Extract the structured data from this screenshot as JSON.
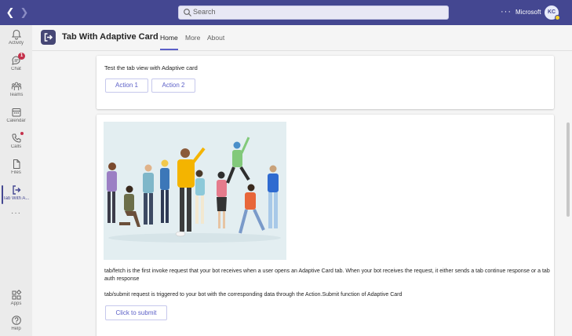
{
  "titlebar": {
    "search_placeholder": "Search",
    "org_name": "Microsoft",
    "avatar_initials": "KC",
    "more_glyph": "···"
  },
  "rail": {
    "items": [
      {
        "label": "Activity",
        "icon": "bell-icon"
      },
      {
        "label": "Chat",
        "icon": "chat-icon",
        "badge": "1"
      },
      {
        "label": "Teams",
        "icon": "teams-icon"
      },
      {
        "label": "Calendar",
        "icon": "calendar-icon"
      },
      {
        "label": "Calls",
        "icon": "phone-icon"
      },
      {
        "label": "Files",
        "icon": "file-icon"
      },
      {
        "label": "Tab With A...",
        "icon": "app-icon"
      },
      {
        "label": "Apps",
        "icon": "apps-icon"
      },
      {
        "label": "Help",
        "icon": "help-icon"
      }
    ],
    "more_glyph": "···"
  },
  "header": {
    "app_title": "Tab With Adaptive Card",
    "tabs": [
      {
        "label": "Home",
        "active": true
      },
      {
        "label": "More",
        "active": false
      },
      {
        "label": "About",
        "active": false
      }
    ]
  },
  "card1": {
    "text": "Test the tab view with Adaptive card",
    "action1": "Action 1",
    "action2": "Action 2"
  },
  "card2": {
    "para1": "tab/fetch is the first invoke request that your bot receives when a user opens an Adaptive Card tab. When your bot receives the request, it either sends a tab continue response or a tab auth response",
    "para2": "tab/submit request is triggered to your bot with the corresponding data through the Action.Submit function of Adaptive Card",
    "submit": "Click to submit"
  },
  "colors": {
    "brand": "#444791",
    "accent": "#5b5fc7",
    "badge": "#c4314b"
  }
}
